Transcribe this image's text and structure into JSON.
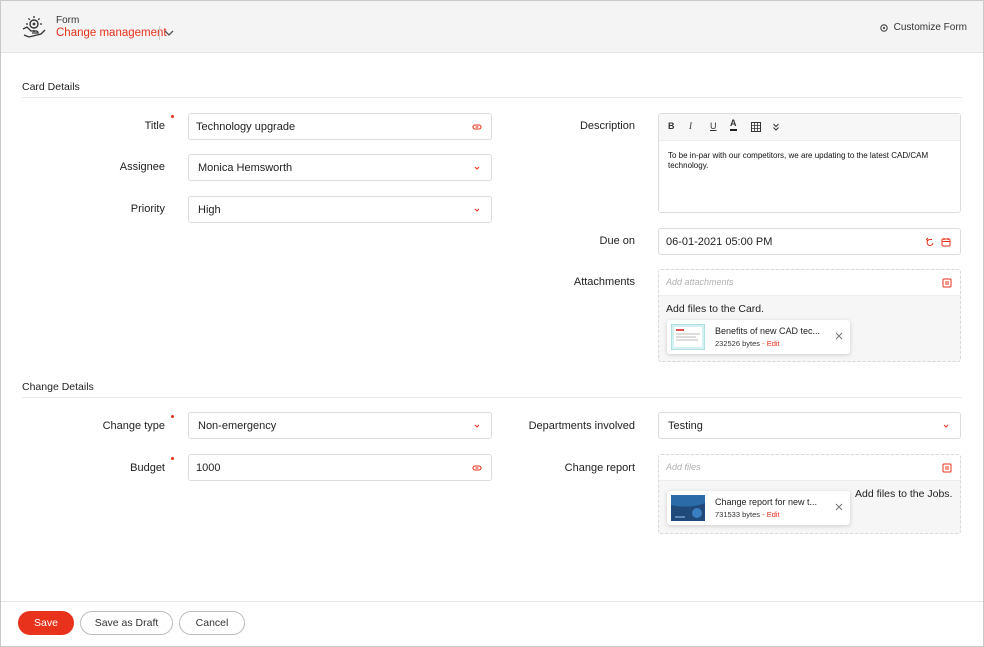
{
  "header": {
    "form_label": "Form",
    "form_name": "Change management",
    "customize_label": "Customize Form"
  },
  "sections": {
    "card_details": "Card Details",
    "change_details": "Change Details"
  },
  "fields": {
    "title": {
      "label": "Title",
      "value": "Technology upgrade",
      "required": true
    },
    "assignee": {
      "label": "Assignee",
      "value": "Monica Hemsworth"
    },
    "priority": {
      "label": "Priority",
      "value": "High"
    },
    "description": {
      "label": "Description",
      "value": "To be in-par with our competitors, we are updating to the latest CAD/CAM technology.",
      "toolbar": [
        "B",
        "I",
        "U",
        "A",
        "table",
        "more"
      ]
    },
    "due_on": {
      "label": "Due on",
      "value": "06-01-2021 05:00 PM"
    },
    "attachments": {
      "label": "Attachments",
      "placeholder": "Add attachments",
      "hint": "Add files to the Card.",
      "file": {
        "name": "Benefits of new CAD tec...",
        "size": "232526 bytes",
        "edit": "- Edit"
      }
    },
    "change_type": {
      "label": "Change type",
      "value": "Non-emergency",
      "required": true
    },
    "budget": {
      "label": "Budget",
      "value": "1000",
      "required": true
    },
    "departments": {
      "label": "Departments involved",
      "value": "Testing"
    },
    "change_report": {
      "label": "Change report",
      "placeholder": "Add files",
      "hint": "Add files to the Jobs.",
      "file": {
        "name": "Change report for new t...",
        "size": "731533 bytes",
        "edit": "- Edit"
      }
    }
  },
  "footer": {
    "save": "Save",
    "save_draft": "Save as Draft",
    "cancel": "Cancel"
  },
  "colors": {
    "accent": "#e8321b",
    "header_bg": "#f4f4f4",
    "border": "#dcdcdc"
  },
  "icons": {
    "form": "form-workflow-icon",
    "dropdown": "chevron-down-icon",
    "customize": "gear-icon",
    "link": "link-icon",
    "upload": "upload-icon",
    "close": "close-icon",
    "reset": "reset-icon",
    "calendar": "calendar-icon"
  }
}
